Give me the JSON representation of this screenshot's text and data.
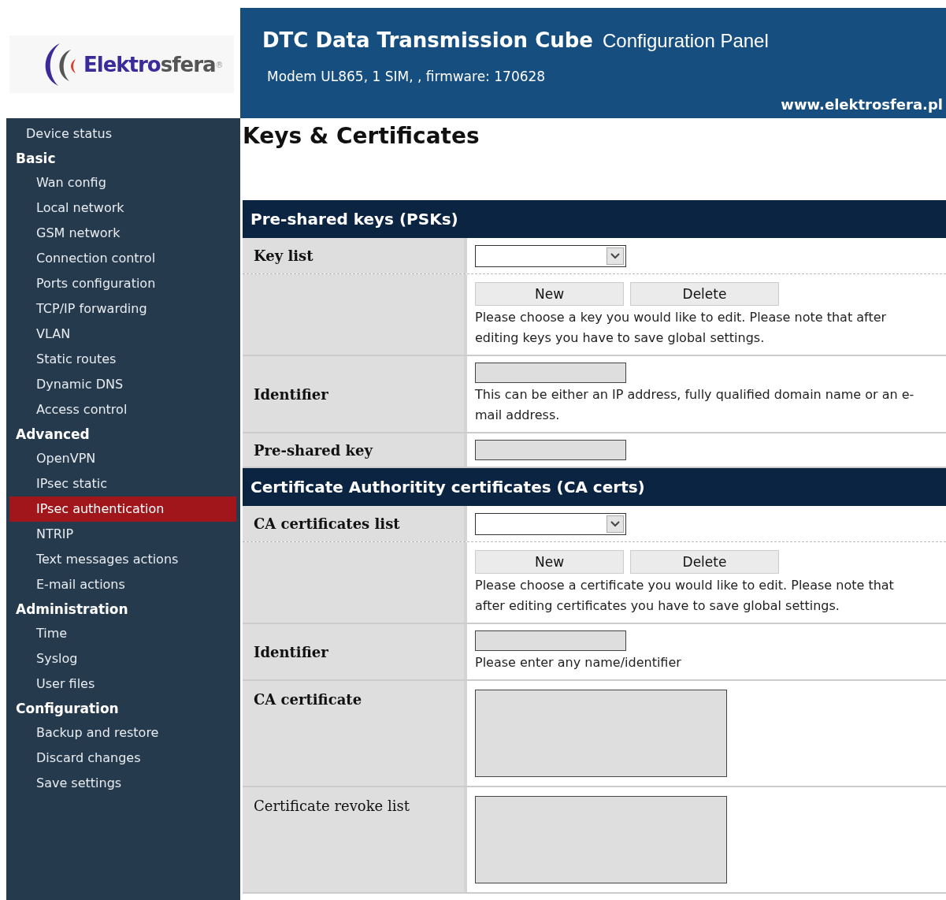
{
  "logo": {
    "brand_parts": [
      "Elektro",
      "sfera"
    ],
    "mark": "®"
  },
  "header": {
    "title": "DTC Data Transmission Cube",
    "subtitle": "Configuration Panel",
    "device": "Modem UL865, 1 SIM, , firmware: 170628",
    "url": "www.elektrosfera.pl"
  },
  "sidebar": {
    "items": [
      {
        "kind": "item",
        "label": "Device status",
        "selected": false
      },
      {
        "kind": "group",
        "label": "Basic",
        "children": [
          {
            "label": "Wan config",
            "selected": false
          },
          {
            "label": "Local network",
            "selected": false
          },
          {
            "label": "GSM network",
            "selected": false
          },
          {
            "label": "Connection control",
            "selected": false
          },
          {
            "label": "Ports configuration",
            "selected": false
          },
          {
            "label": "TCP/IP forwarding",
            "selected": false
          },
          {
            "label": "VLAN",
            "selected": false
          },
          {
            "label": "Static routes",
            "selected": false
          },
          {
            "label": "Dynamic DNS",
            "selected": false
          },
          {
            "label": "Access control",
            "selected": false
          }
        ]
      },
      {
        "kind": "group",
        "label": "Advanced",
        "children": [
          {
            "label": "OpenVPN",
            "selected": false
          },
          {
            "label": "IPsec static",
            "selected": false
          },
          {
            "label": "IPsec authentication",
            "selected": true
          },
          {
            "label": "NTRIP",
            "selected": false
          },
          {
            "label": "Text messages actions",
            "selected": false
          },
          {
            "label": "E-mail actions",
            "selected": false
          }
        ]
      },
      {
        "kind": "group",
        "label": "Administration",
        "children": [
          {
            "label": "Time",
            "selected": false
          },
          {
            "label": "Syslog",
            "selected": false
          },
          {
            "label": "User files",
            "selected": false
          }
        ]
      },
      {
        "kind": "group",
        "label": "Configuration",
        "children": [
          {
            "label": "Backup and restore",
            "selected": false
          },
          {
            "label": "Discard changes",
            "selected": false
          },
          {
            "label": "Save settings",
            "selected": false
          }
        ]
      }
    ]
  },
  "page_title": "Keys & Certificates",
  "sections": [
    {
      "title": "Pre-shared keys (PSKs)",
      "rows": [
        {
          "kind": "select",
          "label": "Key list",
          "bold": true
        },
        {
          "kind": "buttons",
          "buttons": [
            "New",
            "Delete"
          ],
          "note": "Please choose a key you would like to edit. Please note that after editing keys you have to save global settings."
        },
        {
          "kind": "input",
          "label": "Identifier",
          "bold": true,
          "note": "This can be either an IP address, fully qualified domain name or an e-mail address."
        },
        {
          "kind": "input",
          "label": "Pre-shared key",
          "bold": true
        }
      ]
    },
    {
      "title": "Certificate Authoritity certificates (CA certs)",
      "rows": [
        {
          "kind": "select",
          "label": "CA certificates list",
          "bold": true
        },
        {
          "kind": "buttons",
          "buttons": [
            "New",
            "Delete"
          ],
          "note": "Please choose a certificate you would like to edit. Please note that after editing certificates you have to save global settings."
        },
        {
          "kind": "input",
          "label": "Identifier",
          "bold": true,
          "note": "Please enter any name/identifier"
        },
        {
          "kind": "textarea",
          "label": "CA certificate",
          "bold": true
        },
        {
          "kind": "textarea",
          "label": "Certificate revoke list",
          "bold": false
        }
      ]
    }
  ]
}
